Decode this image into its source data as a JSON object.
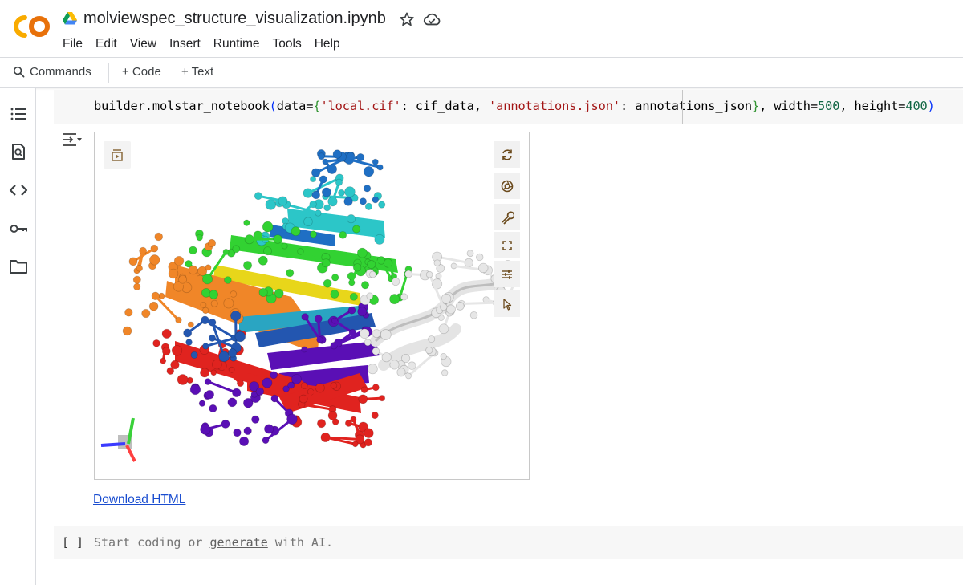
{
  "header": {
    "logo_text": "CO",
    "notebook_title": "molviewspec_structure_visualization.ipynb",
    "menu": [
      "File",
      "Edit",
      "View",
      "Insert",
      "Runtime",
      "Tools",
      "Help"
    ]
  },
  "toolbar": {
    "commands_label": "Commands",
    "code_label": "+ Code",
    "text_label": "+ Text"
  },
  "sidebar": {
    "icons": [
      "table-of-contents-icon",
      "find-icon",
      "code-snippets-icon",
      "secrets-key-icon",
      "files-folder-icon"
    ]
  },
  "cell": {
    "code_parts": [
      {
        "t": "builder.molstar_notebook",
        "c": ""
      },
      {
        "t": "(",
        "c": "par"
      },
      {
        "t": "data=",
        "c": ""
      },
      {
        "t": "{",
        "c": "brk"
      },
      {
        "t": "'local.cif'",
        "c": "str"
      },
      {
        "t": ": cif_data, ",
        "c": ""
      },
      {
        "t": "'annotations.json'",
        "c": "str"
      },
      {
        "t": ": annotations_json",
        "c": ""
      },
      {
        "t": "}",
        "c": "brk"
      },
      {
        "t": ", width=",
        "c": ""
      },
      {
        "t": "500",
        "c": "num"
      },
      {
        "t": ", height=",
        "c": ""
      },
      {
        "t": "400",
        "c": "num"
      },
      {
        "t": ")",
        "c": "par"
      }
    ],
    "download_label": "Download HTML"
  },
  "viewer": {
    "controls": [
      "reset-camera-icon",
      "screenshot-icon",
      "settings-wrench-icon",
      "expand-icon",
      "controls-sliders-icon",
      "selection-pointer-icon"
    ]
  },
  "empty_cell": {
    "brackets": "[ ]",
    "placeholder_before": "Start coding or ",
    "placeholder_link": "generate",
    "placeholder_after": " with AI."
  },
  "colors": {
    "link": "#1a4dd0",
    "string": "#a31515",
    "number": "#116644",
    "cell_bg": "#f7f7f7",
    "logo_orange": "#f9ab00",
    "logo_dark_orange": "#e8710a"
  }
}
